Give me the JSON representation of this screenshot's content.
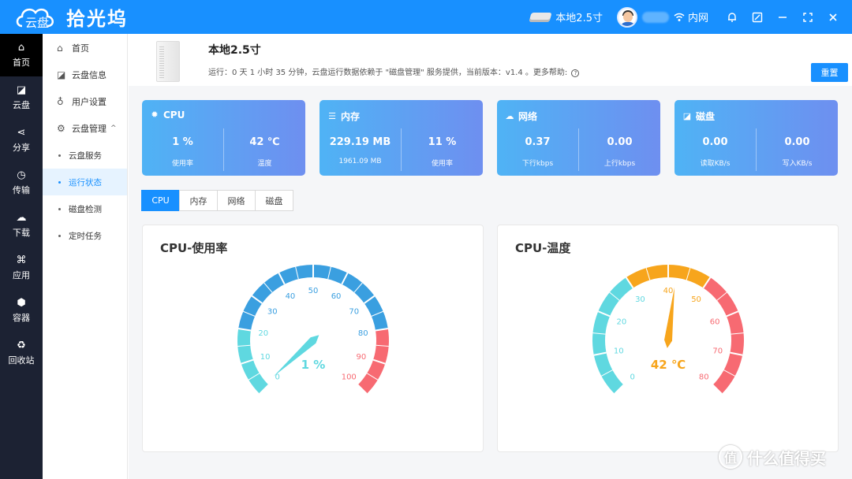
{
  "topbar": {
    "logo_sub": "云盘",
    "app_name": "拾光坞",
    "disk_label": "本地2.5寸",
    "network_label": "内网",
    "icons": [
      "hdd-icon",
      "wifi-icon",
      "bell-icon",
      "edit-icon",
      "minimize-icon",
      "fullscreen-icon",
      "close-icon"
    ]
  },
  "rail": {
    "items": [
      {
        "icon": "home-icon",
        "label": "首页"
      },
      {
        "icon": "cloud-disk-icon",
        "label": "云盘"
      },
      {
        "icon": "share-icon",
        "label": "分享"
      },
      {
        "icon": "transfer-icon",
        "label": "传输"
      },
      {
        "icon": "download-icon",
        "label": "下载"
      },
      {
        "icon": "apps-icon",
        "label": "应用"
      },
      {
        "icon": "container-icon",
        "label": "容器"
      },
      {
        "icon": "recycle-icon",
        "label": "回收站"
      }
    ]
  },
  "submenu": {
    "home": "首页",
    "disk_info": "云盘信息",
    "user_settings": "用户设置",
    "disk_management": "云盘管理",
    "sub_items": [
      "云盘服务",
      "运行状态",
      "磁盘检测",
      "定时任务"
    ]
  },
  "header": {
    "title": "本地2.5寸",
    "run_info": "运行：0 天 1 小时 35 分钟，云盘运行数据依赖于 \"磁盘管理\" 服务提供，当前版本：v1.4 。更多帮助:",
    "help_icon": "?",
    "reset_label": "重置"
  },
  "stats": [
    {
      "title": "CPU",
      "icon": "cpu-icon",
      "v1": "1 %",
      "l1": "使用率",
      "v2": "42 ℃",
      "l2": "温度"
    },
    {
      "title": "内存",
      "icon": "memory-icon",
      "v1": "229.19 MB",
      "l1": "1961.09 MB",
      "v2": "11 %",
      "l2": "使用率"
    },
    {
      "title": "网络",
      "icon": "cloud-icon",
      "v1": "0.37",
      "l1": "下行kbps",
      "v2": "0.00",
      "l2": "上行kbps"
    },
    {
      "title": "磁盘",
      "icon": "disk-icon",
      "v1": "0.00",
      "l1": "读取KB/s",
      "v2": "0.00",
      "l2": "写入KB/s"
    }
  ],
  "tabs": [
    "CPU",
    "内存",
    "网络",
    "磁盘"
  ],
  "panels": {
    "usage_title": "CPU-使用率",
    "temp_title": "CPU-温度"
  },
  "watermark": "什么值得买",
  "chart_data": [
    {
      "type": "gauge",
      "title": "CPU-使用率",
      "value": 1,
      "value_label": "1 %",
      "min": 0,
      "max": 100,
      "ticks": [
        0,
        10,
        20,
        30,
        40,
        50,
        60,
        70,
        80,
        90,
        100
      ],
      "bands": [
        {
          "to": 20,
          "color": "#5fd8e0"
        },
        {
          "to": 80,
          "color": "#3a9fe0"
        },
        {
          "to": 100,
          "color": "#f76a72"
        }
      ],
      "pointer_color": "#5fd8e0"
    },
    {
      "type": "gauge",
      "title": "CPU-温度",
      "value": 42,
      "value_label": "42 ℃",
      "min": 0,
      "max": 80,
      "ticks": [
        0,
        10,
        20,
        30,
        40,
        50,
        60,
        70,
        80
      ],
      "bands": [
        {
          "to": 30,
          "color": "#5fd8e0"
        },
        {
          "to": 50,
          "color": "#f7a51c"
        },
        {
          "to": 80,
          "color": "#f76a72"
        }
      ],
      "pointer_color": "#f7a51c"
    }
  ]
}
